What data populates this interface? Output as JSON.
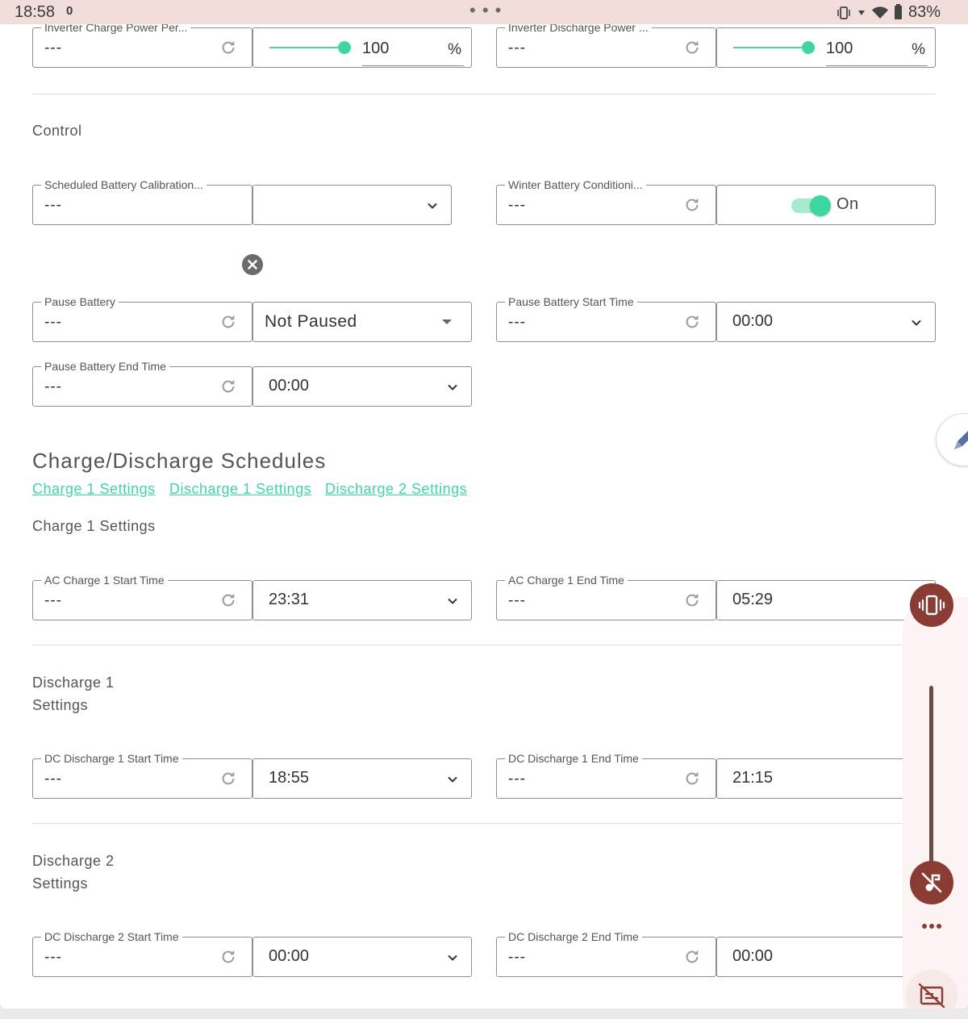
{
  "status_bar": {
    "time": "18:58",
    "notification": "0",
    "battery": "83%",
    "handle": "• • •"
  },
  "colors": {
    "accent": "#3fd6a0",
    "volume_button": "#8a3b33",
    "status_bar_bg": "#f1dedb"
  },
  "top_row": {
    "charge_power": {
      "label": "Inverter Charge Power Per...",
      "value": "---",
      "slider_percent": 100,
      "input_value": "100",
      "unit": "%"
    },
    "discharge_power": {
      "label": "Inverter Discharge Power ...",
      "value": "---",
      "slider_percent": 100,
      "input_value": "100",
      "unit": "%"
    }
  },
  "control": {
    "heading": "Control",
    "calibration": {
      "label": "Scheduled Battery Calibration...",
      "value": "---",
      "selected": ""
    },
    "winter": {
      "label": "Winter Battery Conditioni...",
      "value": "---",
      "toggle_on": true,
      "toggle_label": "On"
    },
    "pause_battery": {
      "label": "Pause Battery",
      "value": "---",
      "selected": "Not Paused"
    },
    "pause_start": {
      "label": "Pause Battery Start Time",
      "value": "---",
      "selected": "00:00"
    },
    "pause_end": {
      "label": "Pause Battery End Time",
      "value": "---",
      "selected": "00:00"
    }
  },
  "schedules": {
    "heading": "Charge/Discharge Schedules",
    "links": [
      "Charge 1 Settings",
      "Discharge 1 Settings",
      "Discharge 2 Settings"
    ],
    "charge1": {
      "heading": "Charge 1 Settings",
      "start": {
        "label": "AC Charge 1 Start Time",
        "value": "---",
        "selected": "23:31"
      },
      "end": {
        "label": "AC Charge 1 End Time",
        "value": "---",
        "selected": "05:29"
      }
    },
    "discharge1": {
      "heading_line1": "Discharge 1",
      "heading_line2": "Settings",
      "start": {
        "label": "DC Discharge 1 Start Time",
        "value": "---",
        "selected": "18:55"
      },
      "end": {
        "label": "DC Discharge 1 End Time",
        "value": "---",
        "selected": "21:15"
      }
    },
    "discharge2": {
      "heading_line1": "Discharge 2",
      "heading_line2": "Settings",
      "start": {
        "label": "DC Discharge 2 Start Time",
        "value": "---",
        "selected": "00:00"
      },
      "end": {
        "label": "DC Discharge 2 End Time",
        "value": "---",
        "selected": "00:00"
      }
    }
  },
  "icons": {
    "refresh": "refresh-icon",
    "chevron": "chevron-down-icon",
    "clear": "clear-icon",
    "edit": "pencil-icon",
    "vibrate": "vibrate-icon",
    "mute": "music-off-icon",
    "more": "more-horizontal-icon",
    "captions": "captions-off-icon"
  }
}
